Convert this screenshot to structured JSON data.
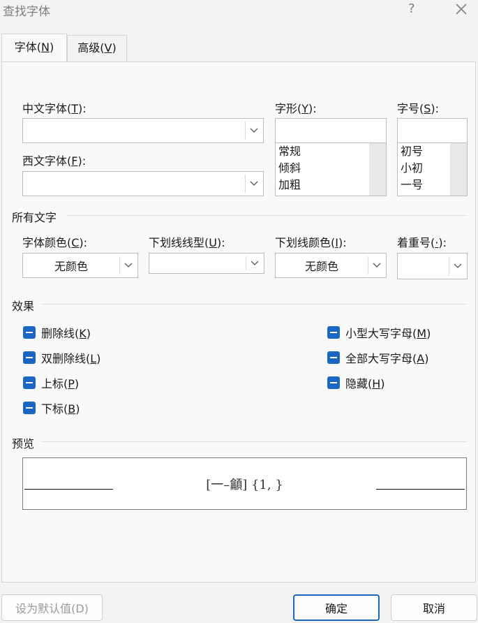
{
  "window": {
    "title": "查找字体",
    "help": "?"
  },
  "tabs": [
    {
      "label": "字体(",
      "key": "N",
      "end": ")"
    },
    {
      "label": "高级(",
      "key": "V",
      "end": ")"
    }
  ],
  "font": {
    "chinese_label": "中文字体(",
    "chinese_key": "T",
    "chinese_end": "):",
    "chinese_value": "",
    "western_label": "西文字体(",
    "western_key": "F",
    "western_end": "):",
    "western_value": "",
    "style_label": "字形(",
    "style_key": "Y",
    "style_end": "):",
    "style_value": "",
    "style_options": [
      "常规",
      "倾斜",
      "加粗"
    ],
    "size_label": "字号(",
    "size_key": "S",
    "size_end": "):",
    "size_value": "",
    "size_options": [
      "初号",
      "小初",
      "一号"
    ]
  },
  "all_text": {
    "heading": "所有文字",
    "color_label": "字体颜色(",
    "color_key": "C",
    "color_end": "):",
    "color_value": "无颜色",
    "underline_label": "下划线线型(",
    "underline_key": "U",
    "underline_end": "):",
    "underline_value": "",
    "underline_color_label": "下划线颜色(",
    "underline_color_key": "I",
    "underline_color_end": "):",
    "underline_color_value": "无颜色",
    "emphasis_label": "着重号(",
    "emphasis_key": "·",
    "emphasis_end": "):",
    "emphasis_value": ""
  },
  "effects": {
    "heading": "效果",
    "strikethrough": {
      "label": "删除线(",
      "key": "K",
      "end": ")"
    },
    "double_strikethrough": {
      "label": "双删除线(",
      "key": "L",
      "end": ")"
    },
    "superscript": {
      "label": "上标(",
      "key": "P",
      "end": ")"
    },
    "subscript": {
      "label": "下标(",
      "key": "B",
      "end": ")"
    },
    "small_caps": {
      "label": "小型大写字母(",
      "key": "M",
      "end": ")"
    },
    "all_caps": {
      "label": "全部大写字母(",
      "key": "A",
      "end": ")"
    },
    "hidden": {
      "label": "隐藏(",
      "key": "H",
      "end": ")"
    },
    "state": "indeterminate"
  },
  "preview": {
    "heading": "预览",
    "sample": "[一–龥] {1, }"
  },
  "buttons": {
    "default": "设为默认值(D)",
    "ok": "确定",
    "cancel": "取消"
  },
  "colors": {
    "accent": "#1a66c4",
    "background": "#f3f3f3",
    "panel": "#f9f9f9"
  }
}
